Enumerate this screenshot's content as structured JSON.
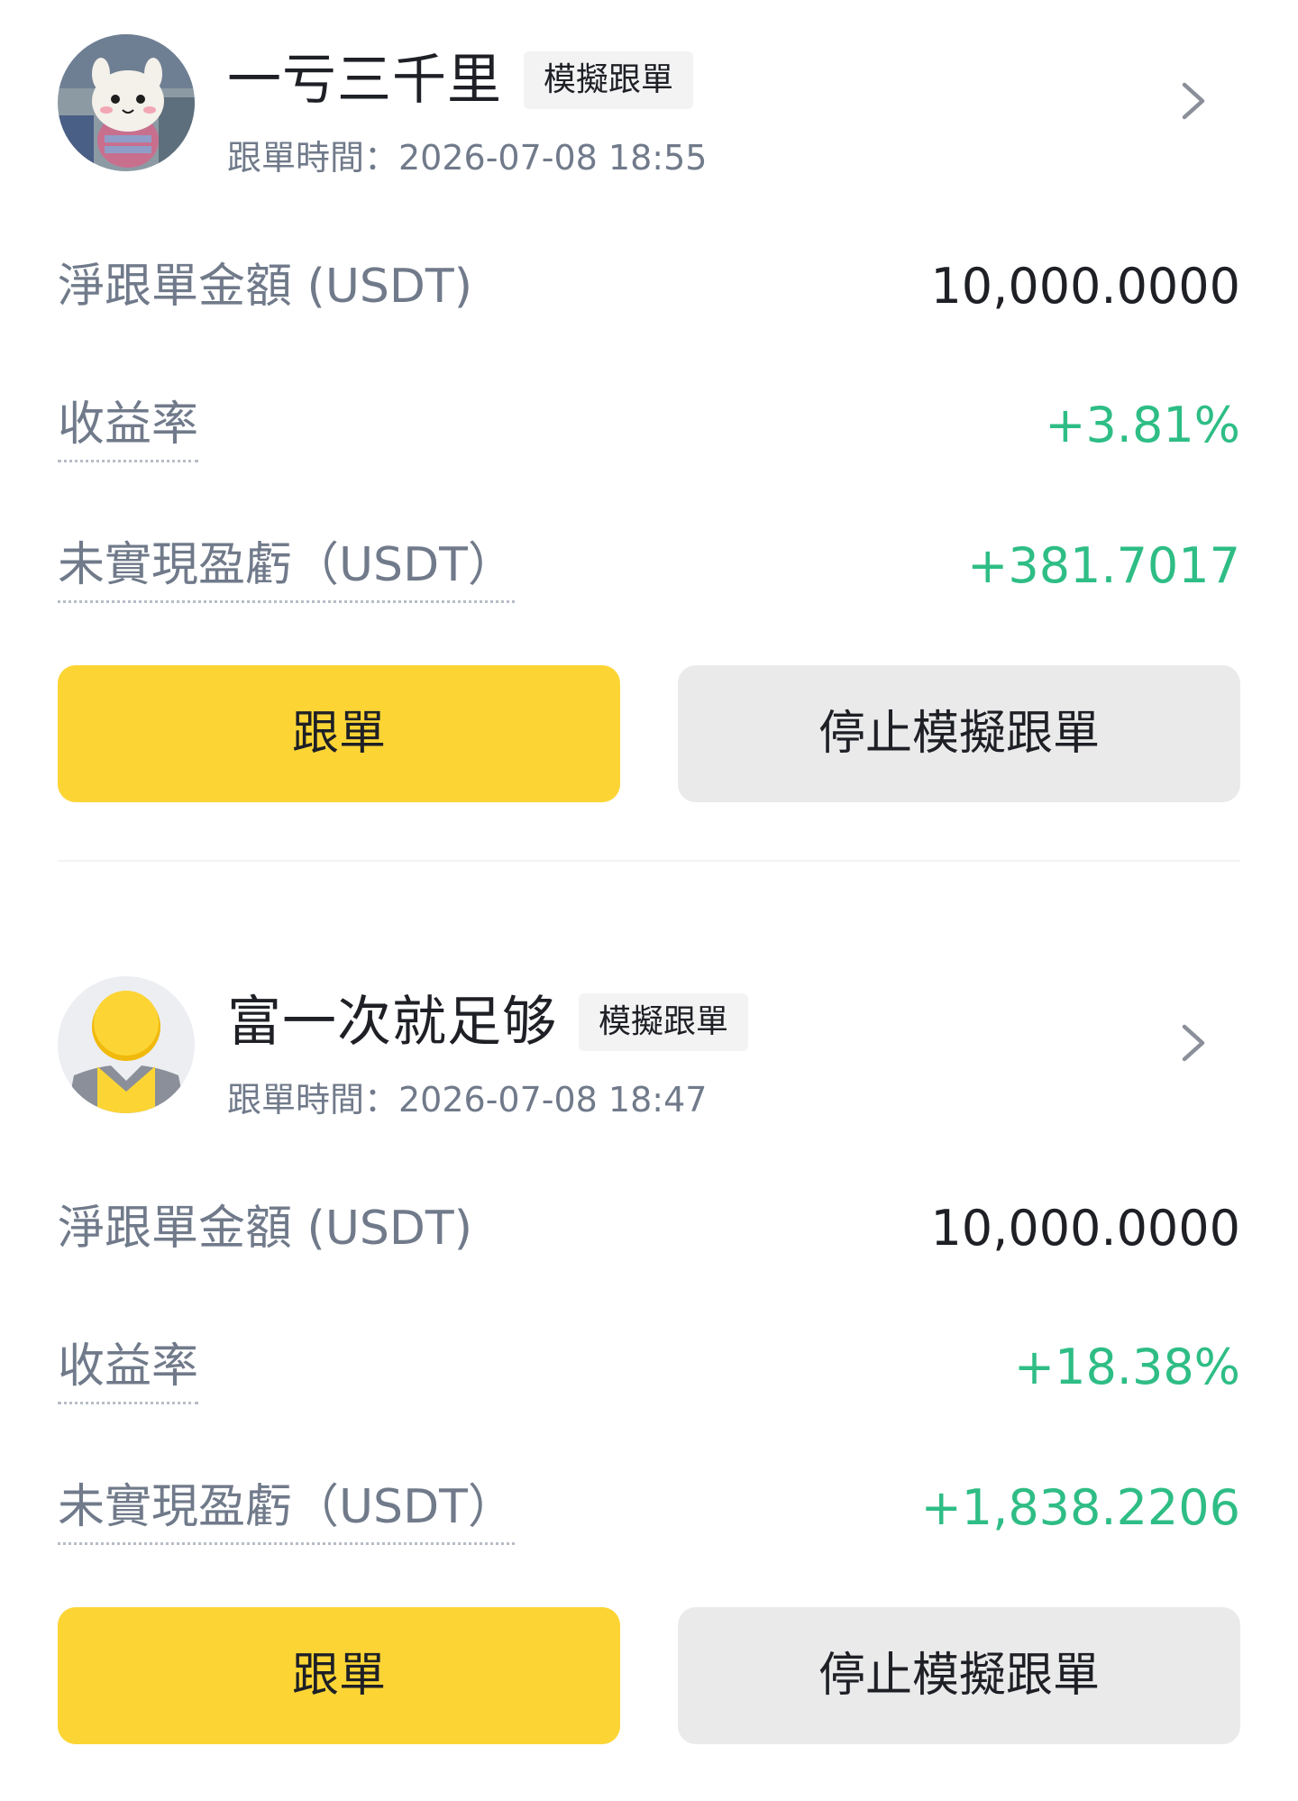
{
  "cards": [
    {
      "trader_name": "一亏三千里",
      "tag": "模擬跟單",
      "follow_time": "跟單時間：2026-07-08 18:55",
      "net_amount_label": "淨跟單金額 (USDT)",
      "net_amount_value": "10,000.0000",
      "roi_label": "收益率",
      "roi_value": "+3.81%",
      "pnl_label": "未實現盈虧（USDT）",
      "pnl_value": "+381.7017",
      "follow_button": "跟單",
      "stop_button": "停止模擬跟單",
      "avatar_icon": "stuffed-bunny-avatar"
    },
    {
      "trader_name": "富一次就足够",
      "tag": "模擬跟單",
      "follow_time": "跟單時間：2026-07-08 18:47",
      "net_amount_label": "淨跟單金額 (USDT)",
      "net_amount_value": "10,000.0000",
      "roi_label": "收益率",
      "roi_value": "+18.38%",
      "pnl_label": "未實現盈虧（USDT）",
      "pnl_value": "+1,838.2206",
      "follow_button": "跟單",
      "stop_button": "停止模擬跟單",
      "avatar_icon": "default-user-avatar"
    }
  ],
  "colors": {
    "primary_yellow": "#fcd535",
    "positive_green": "#2ebd85",
    "secondary_text": "#707a8a",
    "primary_text": "#1e2026",
    "button_gray": "#eaeaea"
  }
}
